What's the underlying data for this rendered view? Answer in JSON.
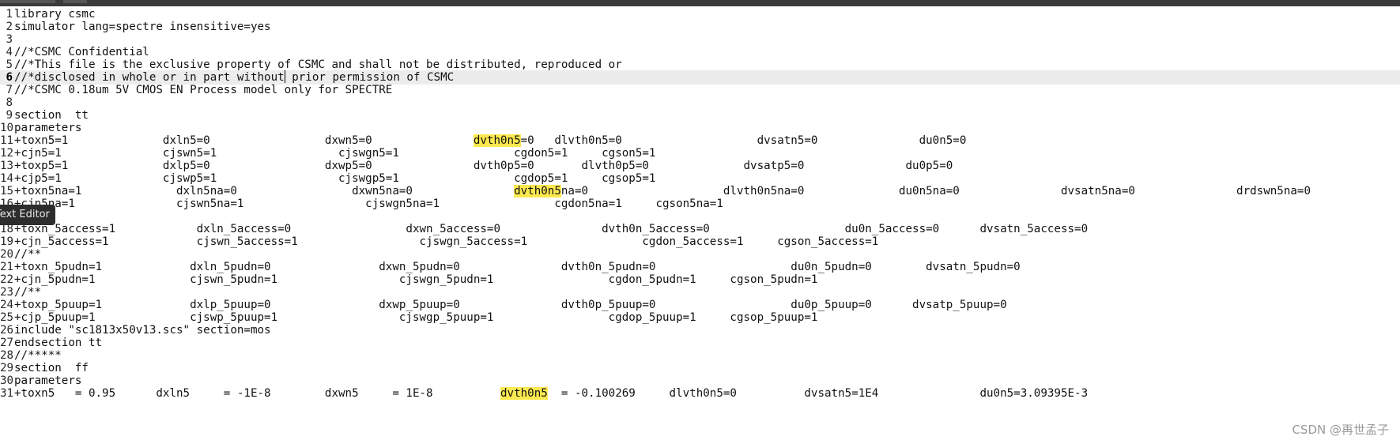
{
  "tooltip": "Text Editor",
  "watermark": "CSDN @再世孟子",
  "colors": {
    "highlight": "#fce94f",
    "current_line": "#ececec"
  },
  "lines": [
    {
      "num": "1",
      "text": "library csmc"
    },
    {
      "num": "2",
      "text": "simulator lang=spectre insensitive=yes"
    },
    {
      "num": "3",
      "text": ""
    },
    {
      "num": "4",
      "text": "//*CSMC Confidential"
    },
    {
      "num": "5",
      "text": "//*This file is the exclusive property of CSMC and shall not be distributed, reproduced or"
    },
    {
      "num": "6",
      "text_before_caret": "//*disclosed in whole or in part without",
      "text_after_caret": " prior permission of CSMC"
    },
    {
      "num": "7",
      "text": "//*CSMC 0.18um 5V CMOS EN Process model only for SPECTRE"
    },
    {
      "num": "8",
      "text": ""
    },
    {
      "num": "9",
      "text": "section  tt"
    },
    {
      "num": "10",
      "text": "parameters"
    },
    {
      "num": "11",
      "text_pre": "+toxn5=1              dxln5=0                 dxwn5=0               ",
      "hl": "dvth0n5",
      "text_post": "=0   dlvth0n5=0                    dvsatn5=0               du0n5=0"
    },
    {
      "num": "12",
      "text": "+cjn5=1               cjswn5=1                  cjswgn5=1                 cgdon5=1     cgson5=1"
    },
    {
      "num": "13",
      "text": "+toxp5=1              dxlp5=0                 dxwp5=0               dvth0p5=0       dlvth0p5=0              dvsatp5=0               du0p5=0"
    },
    {
      "num": "14",
      "text": "+cjp5=1               cjswp5=1                  cjswgp5=1                 cgdop5=1     cgsop5=1"
    },
    {
      "num": "15",
      "text_pre": "+toxn5na=1              dxln5na=0                 dxwn5na=0               ",
      "hl": "dvth0n5",
      "text_post": "na=0                    dlvth0n5na=0              du0n5na=0               dvsatn5na=0               drdswn5na=0"
    },
    {
      "num": "16",
      "text": "+cjn5na=1               cjswn5na=1                  cjswgn5na=1                 cgdon5na=1     cgson5na=1"
    },
    {
      "num": "17",
      "text": "//**"
    },
    {
      "num": "18",
      "text": "+toxn_5access=1            dxln_5access=0                 dxwn_5access=0               dvth0n_5access=0                    du0n_5access=0      dvsatn_5access=0"
    },
    {
      "num": "19",
      "text": "+cjn_5access=1             cjswn_5access=1                  cjswgn_5access=1                 cgdon_5access=1     cgson_5access=1"
    },
    {
      "num": "20",
      "text": "//**"
    },
    {
      "num": "21",
      "text": "+toxn_5pudn=1             dxln_5pudn=0                dxwn_5pudn=0               dvth0n_5pudn=0                    du0n_5pudn=0        dvsatn_5pudn=0"
    },
    {
      "num": "22",
      "text": "+cjn_5pudn=1              cjswn_5pudn=1                  cjswgn_5pudn=1                 cgdon_5pudn=1     cgson_5pudn=1"
    },
    {
      "num": "23",
      "text": "//**"
    },
    {
      "num": "24",
      "text": "+toxp_5puup=1             dxlp_5puup=0                dxwp_5puup=0               dvth0p_5puup=0                    du0p_5puup=0      dvsatp_5puup=0"
    },
    {
      "num": "25",
      "text": "+cjp_5puup=1              cjswp_5puup=1                  cjswgp_5puup=1                 cgdop_5puup=1     cgsop_5puup=1"
    },
    {
      "num": "26",
      "text": "include \"sc1813x50v13.scs\" section=mos"
    },
    {
      "num": "27",
      "text": "endsection tt"
    },
    {
      "num": "28",
      "text": "//*****"
    },
    {
      "num": "29",
      "text": "section  ff"
    },
    {
      "num": "30",
      "text": "parameters"
    },
    {
      "num": "31",
      "text_pre": "+toxn5   = 0.95      dxln5     = -1E-8        dxwn5     = 1E-8          ",
      "hl": "dvth0n5",
      "text_post": "  = -0.100269     dlvth0n5=0          dvsatn5=1E4               du0n5=3.09395E-3"
    }
  ]
}
